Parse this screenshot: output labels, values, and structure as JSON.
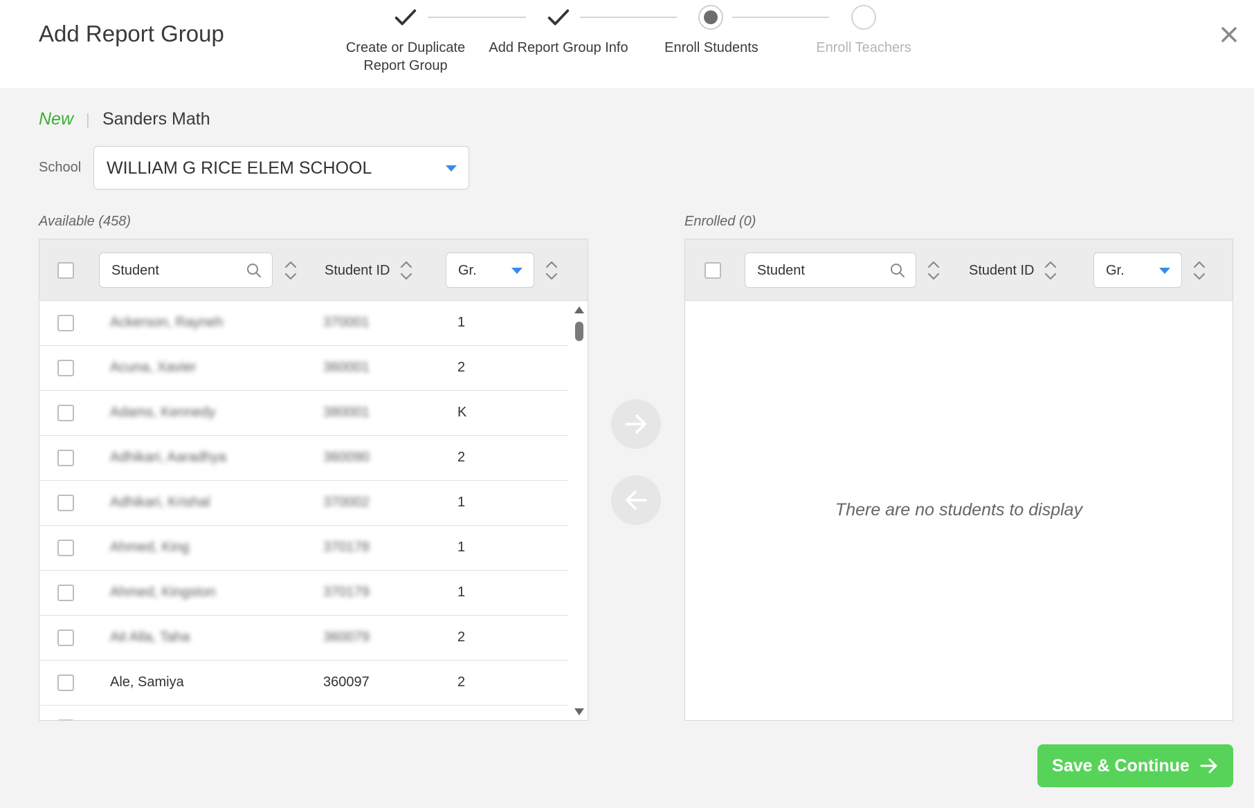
{
  "header": {
    "title": "Add Report Group",
    "steps": [
      {
        "label": "Create or Duplicate\nReport Group",
        "status": "complete"
      },
      {
        "label": "Add Report Group Info",
        "status": "complete"
      },
      {
        "label": "Enroll Students",
        "status": "current"
      },
      {
        "label": "Enroll Teachers",
        "status": "future"
      }
    ]
  },
  "breadcrumb": {
    "status": "New",
    "group_name": "Sanders Math"
  },
  "school": {
    "label": "School",
    "value": "WILLIAM G RICE ELEM SCHOOL"
  },
  "available": {
    "label": "Available (458)",
    "columns": {
      "student_placeholder": "Student",
      "student_id": "Student ID",
      "grade": "Gr."
    },
    "rows": [
      {
        "name": "Ackerson, Rayneh",
        "id": "370001",
        "grade": "1"
      },
      {
        "name": "Acuna, Xavier",
        "id": "360001",
        "grade": "2"
      },
      {
        "name": "Adams, Kennedy",
        "id": "380001",
        "grade": "K"
      },
      {
        "name": "Adhikari, Aaradhya",
        "id": "360090",
        "grade": "2"
      },
      {
        "name": "Adhikari, Krishal",
        "id": "370002",
        "grade": "1"
      },
      {
        "name": "Ahmed, King",
        "id": "370178",
        "grade": "1"
      },
      {
        "name": "Ahmed, Kingston",
        "id": "370179",
        "grade": "1"
      },
      {
        "name": "Ait Alla, Taha",
        "id": "360079",
        "grade": "2"
      },
      {
        "name": "Ale, Samiya",
        "id": "360097",
        "grade": "2"
      }
    ]
  },
  "enrolled": {
    "label": "Enrolled (0)",
    "columns": {
      "student_placeholder": "Student",
      "student_id": "Student ID",
      "grade": "Gr."
    },
    "empty_message": "There are no students to display"
  },
  "actions": {
    "save_label": "Save & Continue"
  },
  "colors": {
    "accent_green": "#58d35a",
    "new_green": "#3cb02f",
    "caret_blue": "#3a8ae8"
  }
}
